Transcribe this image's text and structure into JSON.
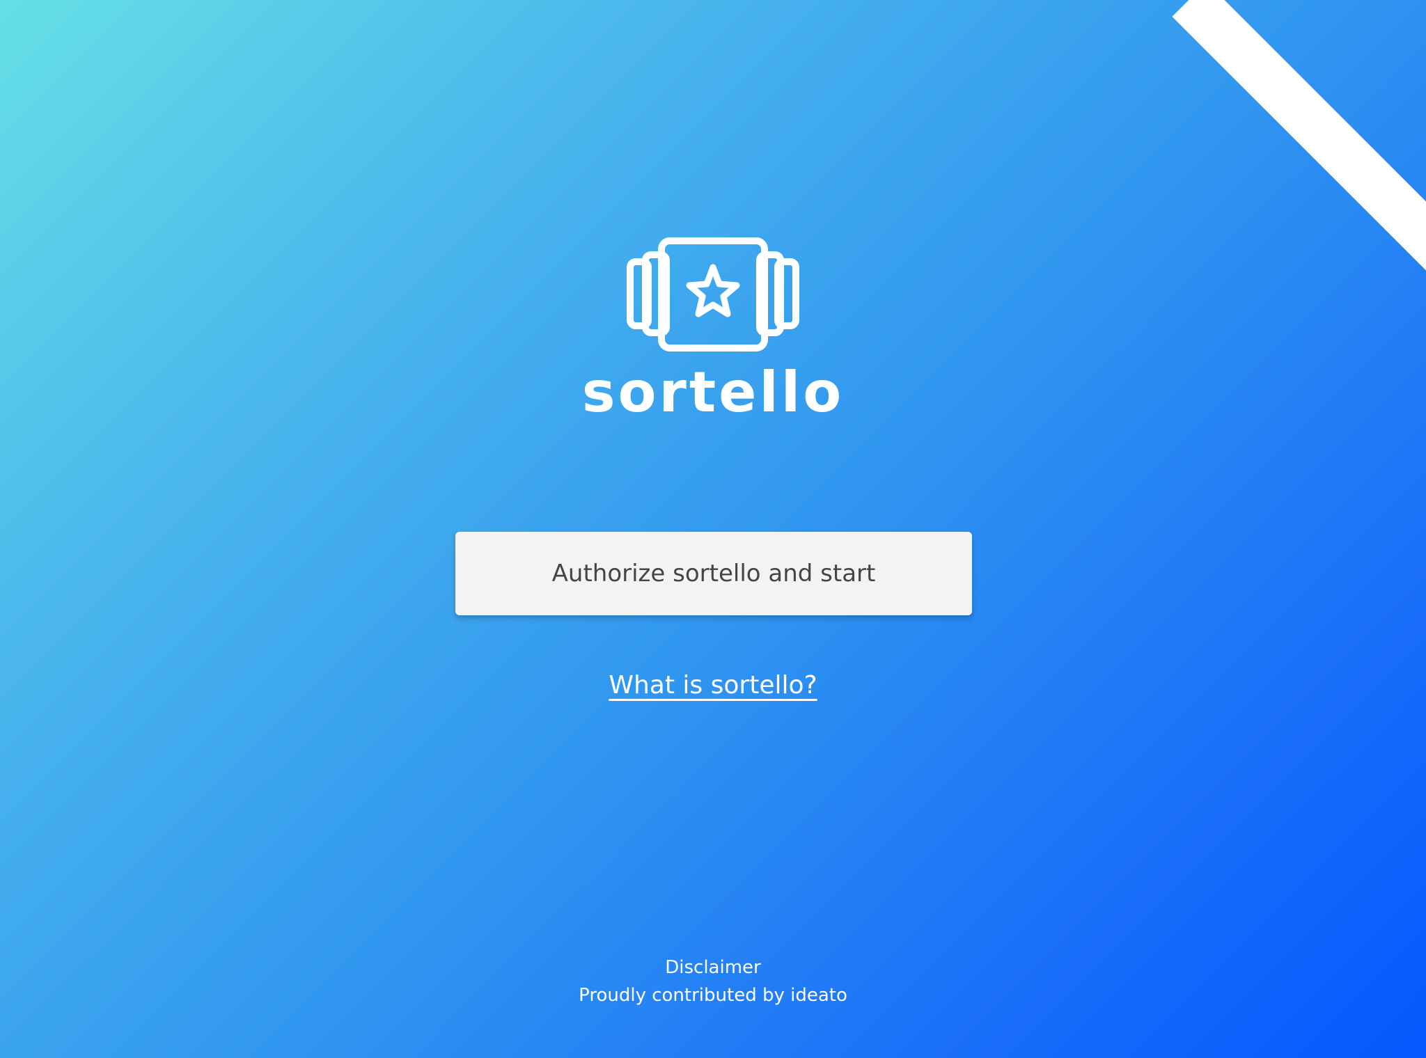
{
  "app": {
    "name": "sortello"
  },
  "actions": {
    "authorize_label": "Authorize sortello and start",
    "what_is_label": "What is sortello?"
  },
  "footer": {
    "disclaimer_label": "Disclaimer",
    "credit_label": "Proudly contributed by ideato"
  },
  "icons": {
    "logo": "stacked-cards-star-icon",
    "ribbon": "corner-ribbon"
  },
  "colors": {
    "gradient_start": "#65e0e6",
    "gradient_end": "#0557ff",
    "button_bg": "#f3f3f3",
    "button_text": "#454545",
    "text": "#ffffff"
  }
}
